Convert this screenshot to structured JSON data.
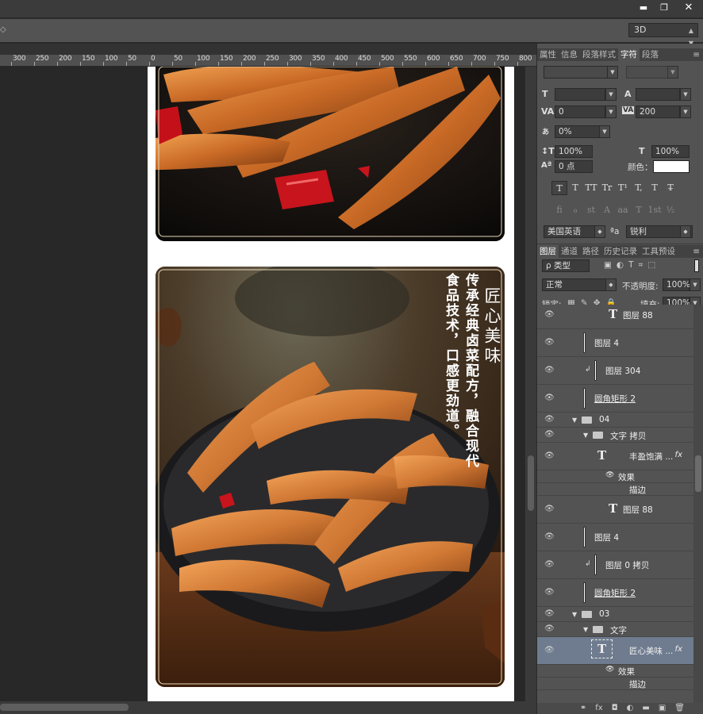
{
  "window": {
    "minimize": "▬",
    "restore": "❐",
    "close": "✕"
  },
  "options_bar": {
    "left_glyph": "◇",
    "mode_select": "3D"
  },
  "ruler_ticks": [
    "300",
    "250",
    "200",
    "150",
    "100",
    "50",
    "0",
    "50",
    "100",
    "150",
    "200",
    "250",
    "300",
    "350",
    "400",
    "450",
    "500",
    "550",
    "600",
    "650",
    "700",
    "750",
    "800"
  ],
  "artwork": {
    "title": "匠心美味",
    "line1": "传承经典卤菜配方，融合现代",
    "line2": "食品技术，口感更劲道。"
  },
  "char_panel": {
    "tabs": [
      "属性",
      "信息",
      "段落样式",
      "字符",
      "段落"
    ],
    "active_tab": "字符",
    "menu": "≡",
    "tracking_value": "0",
    "kerning_value": "200",
    "scale_value": "0%",
    "vscale_value": "100%",
    "hscale_value": "100%",
    "baseline_value": "0 点",
    "color_label": "颜色：",
    "font_style_buttons": [
      "T",
      "T",
      "TT",
      "Tr",
      "T¹",
      "T,",
      "T",
      "T̶"
    ],
    "opentype_buttons": [
      "fi",
      "ℴ",
      "st",
      "A",
      "aa",
      "T",
      "1st",
      "½"
    ],
    "language": "美国英语",
    "aa_label": "ªa",
    "antialias": "锐利"
  },
  "layers_panel": {
    "tabs": [
      "图层",
      "通道",
      "路径",
      "历史记录",
      "工具预设"
    ],
    "active_tab": "图层",
    "menu": "≡",
    "filter_label": "ρ 类型",
    "blend_mode": "正常",
    "opacity_label": "不透明度:",
    "opacity_value": "100%",
    "lock_label": "锁定:",
    "fill_label": "填充:",
    "fill_value": "100%",
    "rows": [
      {
        "name": "图层 88",
        "kind": "text",
        "indent": 0
      },
      {
        "name": "图层 4",
        "kind": "white",
        "indent": 0
      },
      {
        "name": "图层 304",
        "kind": "white-clip",
        "indent": 0
      },
      {
        "name": "圆角矩形 2",
        "kind": "white",
        "indent": 0
      },
      {
        "name": "04",
        "kind": "group",
        "indent": 0
      },
      {
        "name": "文字 拷贝",
        "kind": "group",
        "indent": 1
      },
      {
        "name": "丰盈饱满 ...",
        "kind": "text-fx",
        "indent": 2
      },
      {
        "name": "效果",
        "kind": "effect",
        "indent": 3
      },
      {
        "name": "描边",
        "kind": "effect-item",
        "indent": 3
      },
      {
        "name": "图层 88",
        "kind": "text",
        "indent": 0
      },
      {
        "name": "图层 4",
        "kind": "white",
        "indent": 0
      },
      {
        "name": "图层 0 拷贝",
        "kind": "white-clip",
        "indent": 0
      },
      {
        "name": "圆角矩形 2",
        "kind": "white",
        "indent": 0
      },
      {
        "name": "03",
        "kind": "group",
        "indent": 0
      },
      {
        "name": "文字",
        "kind": "group",
        "indent": 1
      },
      {
        "name": "匠心美味 ...",
        "kind": "text-fx-sel",
        "indent": 2
      },
      {
        "name": "效果",
        "kind": "effect",
        "indent": 3
      },
      {
        "name": "描边",
        "kind": "effect-item",
        "indent": 3
      }
    ],
    "fx_label": "fx",
    "bottom_icons": [
      "⚭",
      "fx",
      "◘",
      "◐",
      "▬",
      "▣",
      "🗑"
    ]
  }
}
